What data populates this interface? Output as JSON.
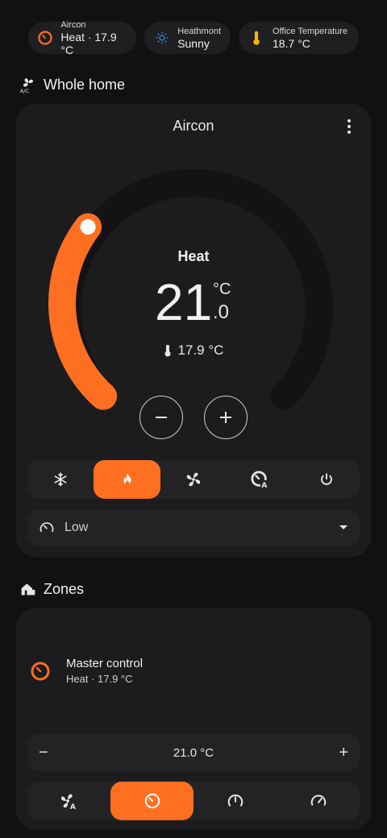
{
  "chips": [
    {
      "label": "Aircon",
      "value": "Heat · 17.9 °C",
      "icon": "thermostat-dial-icon"
    },
    {
      "label": "Heathmont",
      "value": "Sunny",
      "icon": "sun-icon"
    },
    {
      "label": "Office Temperature",
      "value": "18.7 °C",
      "icon": "thermometer-icon"
    }
  ],
  "whole_home": {
    "title": "Whole home",
    "card": {
      "name": "Aircon",
      "mode": "Heat",
      "target_integer": "21",
      "target_decimal": ".0",
      "unit": "°C",
      "current_temp": "17.9 °C",
      "modes": [
        "cool",
        "heat",
        "fan",
        "auto",
        "off"
      ],
      "active_mode": "heat",
      "fan_speed": "Low"
    }
  },
  "zones": {
    "title": "Zones",
    "card": {
      "name": "Master control",
      "state": "Heat · 17.9 °C",
      "temperature": "21.0 °C",
      "minus": "−",
      "plus": "+",
      "buttons": [
        "fan-auto",
        "dial",
        "dial-alt",
        "speedometer"
      ],
      "active_button": "dial"
    }
  },
  "colors": {
    "accent": "#ff6f22",
    "background": "#111113",
    "card": "#1c1c1f",
    "sun": "#3d8ef0",
    "thermometer": "#f5b400"
  }
}
